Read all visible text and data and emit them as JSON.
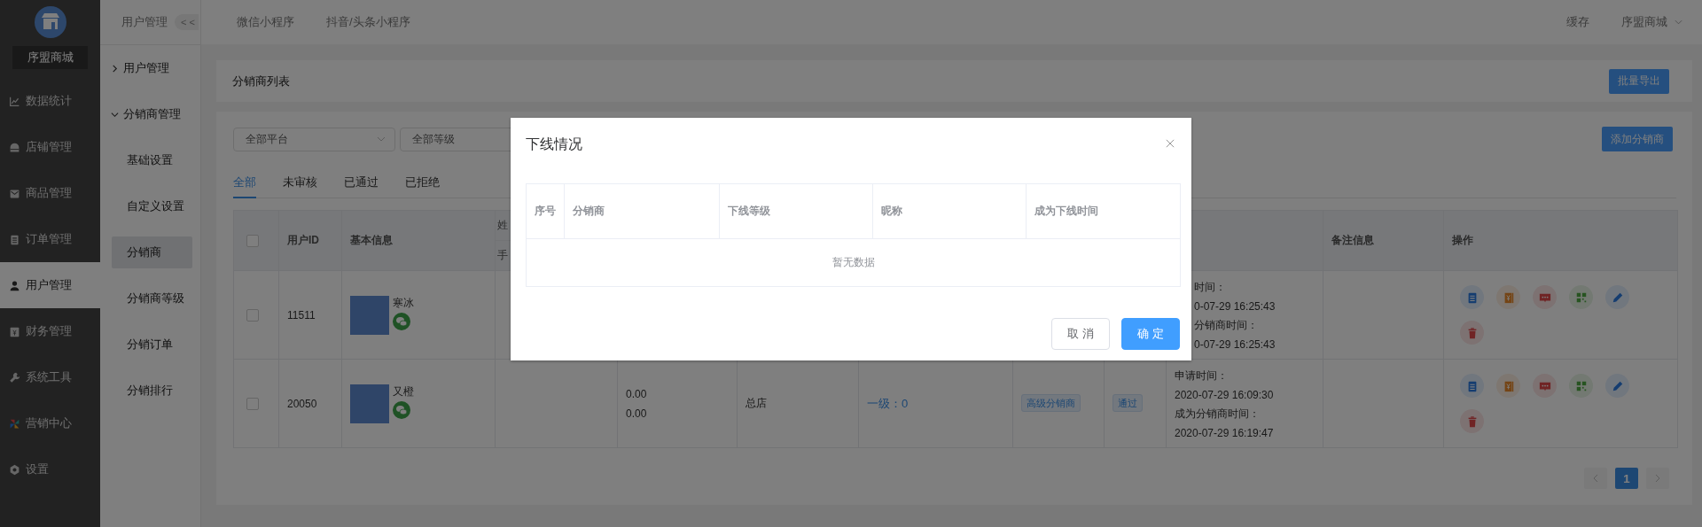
{
  "sidebar": {
    "store_name": "序盟商城",
    "items": [
      {
        "label": "数据统计",
        "kind": "chart",
        "selected": false
      },
      {
        "label": "店铺管理",
        "kind": "store",
        "selected": false
      },
      {
        "label": "商品管理",
        "kind": "mail",
        "selected": false
      },
      {
        "label": "订单管理",
        "kind": "clipboard",
        "selected": false
      },
      {
        "label": "用户管理",
        "kind": "user",
        "selected": true
      },
      {
        "label": "财务管理",
        "kind": "wallet",
        "selected": false
      },
      {
        "label": "系统工具",
        "kind": "wrench",
        "selected": false
      },
      {
        "label": "营销中心",
        "kind": "pinwheel",
        "selected": false
      },
      {
        "label": "设置",
        "kind": "gear",
        "selected": false
      }
    ]
  },
  "subnav": {
    "title": "用户管理",
    "collapse": "< <",
    "groups": [
      {
        "label": "用户管理",
        "expanded": false
      },
      {
        "label": "分销商管理",
        "expanded": true,
        "children": [
          {
            "label": "基础设置",
            "selected": false
          },
          {
            "label": "自定义设置",
            "selected": false
          },
          {
            "label": "分销商",
            "selected": true
          },
          {
            "label": "分销商等级",
            "selected": false
          },
          {
            "label": "分销订单",
            "selected": false
          },
          {
            "label": "分销排行",
            "selected": false
          }
        ]
      }
    ]
  },
  "topbar": {
    "tabs": [
      "微信小程序",
      "抖音/头条小程序"
    ],
    "cache": "缓存",
    "user": "序盟商城"
  },
  "page": {
    "title": "分销商列表",
    "export_button": "批量导出"
  },
  "filters": {
    "selects": [
      "全部平台",
      "全部等级"
    ],
    "add_button": "添加分销商"
  },
  "status_tabs": [
    {
      "label": "全部",
      "selected": true
    },
    {
      "label": "未审核",
      "selected": false
    },
    {
      "label": "已通过",
      "selected": false
    },
    {
      "label": "已拒绝",
      "selected": false
    }
  ],
  "table": {
    "select_all_checked": false,
    "header": {
      "user_id": "用户ID",
      "basic_info": "基本信息",
      "column_4_top": "姓",
      "column_4_bottom": "手",
      "remark": "备注信息",
      "actions": "操作"
    },
    "rows": [
      {
        "checked": false,
        "user_id": "11511",
        "nickname": "寒冰",
        "time_lines": [
          "时间：",
          "0-07-29 16:25:43",
          "分销商时间：",
          "0-07-29 16:25:43"
        ]
      },
      {
        "checked": false,
        "user_id": "20050",
        "nickname": "又橙",
        "amounts": [
          "0.00",
          "0.00"
        ],
        "store": "总店",
        "downline": "一级：0",
        "level_tag": "高级分销商",
        "status_tag": "通过",
        "time_lines": [
          "申请时间：",
          "2020-07-29 16:09:30",
          "成为分销商时间：",
          "2020-07-29 16:19:47"
        ]
      }
    ]
  },
  "pagination": {
    "pages": [
      {
        "label": "1",
        "selected": true
      }
    ]
  },
  "modal": {
    "title": "下线情况",
    "columns": [
      "序号",
      "分销商",
      "下线等级",
      "昵称",
      "成为下线时间"
    ],
    "empty_text": "暂无数据",
    "buttons": [
      {
        "label": "取 消",
        "kind": "default"
      },
      {
        "label": "确 定",
        "kind": "primary"
      }
    ]
  }
}
